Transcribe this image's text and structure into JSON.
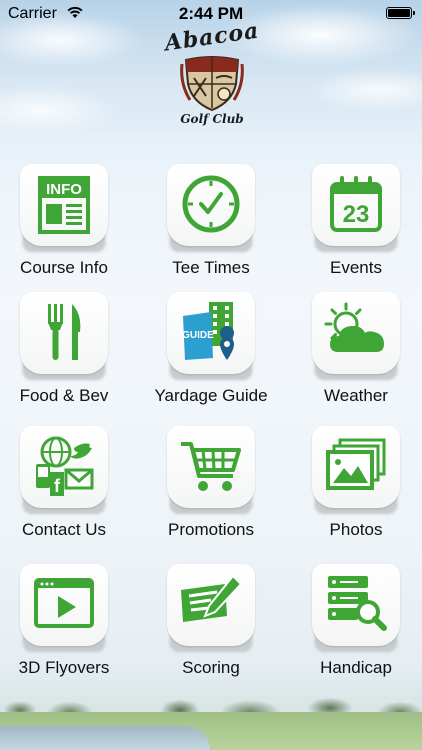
{
  "status_bar": {
    "carrier": "Carrier",
    "time": "2:44 PM"
  },
  "logo": {
    "name": "Abacoa",
    "subtitle": "Golf Club"
  },
  "brand_color": "#3fa535",
  "menu": [
    {
      "label": "Course Info",
      "icon": "info-document-icon"
    },
    {
      "label": "Tee Times",
      "icon": "clock-icon"
    },
    {
      "label": "Events",
      "icon": "calendar-icon",
      "icon_text": "23"
    },
    {
      "label": "Food & Bev",
      "icon": "fork-knife-icon"
    },
    {
      "label": "Yardage Guide",
      "icon": "yardage-guide-icon",
      "icon_text": "GUIDE"
    },
    {
      "label": "Weather",
      "icon": "sun-cloud-icon"
    },
    {
      "label": "Contact Us",
      "icon": "contact-social-icon"
    },
    {
      "label": "Promotions",
      "icon": "shopping-cart-icon"
    },
    {
      "label": "Photos",
      "icon": "photos-icon"
    },
    {
      "label": "3D Flyovers",
      "icon": "video-player-icon"
    },
    {
      "label": "Scoring",
      "icon": "scorecard-pencil-icon"
    },
    {
      "label": "Handicap",
      "icon": "handicap-search-icon"
    }
  ]
}
